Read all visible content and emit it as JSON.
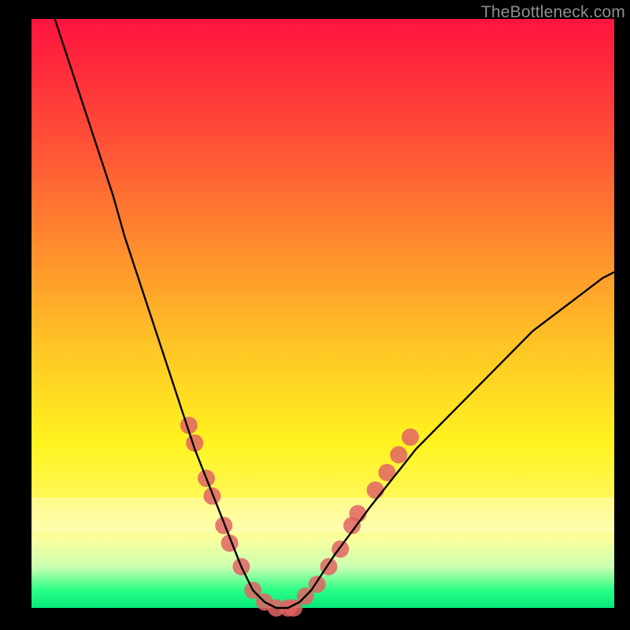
{
  "watermark": "TheBottleneck.com",
  "colors": {
    "curve_stroke": "#000000",
    "marker_fill": "#e06464",
    "background_black": "#000000"
  },
  "chart_data": {
    "type": "line",
    "title": "",
    "xlabel": "",
    "ylabel": "",
    "xlim": [
      0,
      100
    ],
    "ylim": [
      0,
      100
    ],
    "curve": {
      "comment": "V-shaped bottleneck curve; y≈100 at left, dips to ~0 around x≈42, rises to ~56 at right",
      "points": [
        {
          "x": 4,
          "y": 100
        },
        {
          "x": 6,
          "y": 94
        },
        {
          "x": 8,
          "y": 88
        },
        {
          "x": 10,
          "y": 82
        },
        {
          "x": 12,
          "y": 76
        },
        {
          "x": 14,
          "y": 70
        },
        {
          "x": 16,
          "y": 63
        },
        {
          "x": 18,
          "y": 57
        },
        {
          "x": 20,
          "y": 51
        },
        {
          "x": 22,
          "y": 45
        },
        {
          "x": 24,
          "y": 39
        },
        {
          "x": 26,
          "y": 33
        },
        {
          "x": 28,
          "y": 27
        },
        {
          "x": 30,
          "y": 22
        },
        {
          "x": 32,
          "y": 17
        },
        {
          "x": 34,
          "y": 12
        },
        {
          "x": 36,
          "y": 7
        },
        {
          "x": 38,
          "y": 3
        },
        {
          "x": 40,
          "y": 1
        },
        {
          "x": 42,
          "y": 0
        },
        {
          "x": 44,
          "y": 0
        },
        {
          "x": 46,
          "y": 1
        },
        {
          "x": 48,
          "y": 3
        },
        {
          "x": 50,
          "y": 6
        },
        {
          "x": 52,
          "y": 9
        },
        {
          "x": 55,
          "y": 13
        },
        {
          "x": 58,
          "y": 17
        },
        {
          "x": 62,
          "y": 22
        },
        {
          "x": 66,
          "y": 27
        },
        {
          "x": 70,
          "y": 31
        },
        {
          "x": 74,
          "y": 35
        },
        {
          "x": 78,
          "y": 39
        },
        {
          "x": 82,
          "y": 43
        },
        {
          "x": 86,
          "y": 47
        },
        {
          "x": 90,
          "y": 50
        },
        {
          "x": 94,
          "y": 53
        },
        {
          "x": 98,
          "y": 56
        },
        {
          "x": 100,
          "y": 57
        }
      ]
    },
    "markers": {
      "comment": "Salmon circular scatter points clustered around the valley",
      "points": [
        {
          "x": 27,
          "y": 31
        },
        {
          "x": 28,
          "y": 28
        },
        {
          "x": 30,
          "y": 22
        },
        {
          "x": 31,
          "y": 19
        },
        {
          "x": 33,
          "y": 14
        },
        {
          "x": 34,
          "y": 11
        },
        {
          "x": 36,
          "y": 7
        },
        {
          "x": 38,
          "y": 3
        },
        {
          "x": 40,
          "y": 1
        },
        {
          "x": 42,
          "y": 0
        },
        {
          "x": 44,
          "y": 0
        },
        {
          "x": 45,
          "y": 0
        },
        {
          "x": 47,
          "y": 2
        },
        {
          "x": 49,
          "y": 4
        },
        {
          "x": 51,
          "y": 7
        },
        {
          "x": 53,
          "y": 10
        },
        {
          "x": 55,
          "y": 14
        },
        {
          "x": 56,
          "y": 16
        },
        {
          "x": 59,
          "y": 20
        },
        {
          "x": 61,
          "y": 23
        },
        {
          "x": 63,
          "y": 26
        },
        {
          "x": 65,
          "y": 29
        }
      ]
    }
  }
}
